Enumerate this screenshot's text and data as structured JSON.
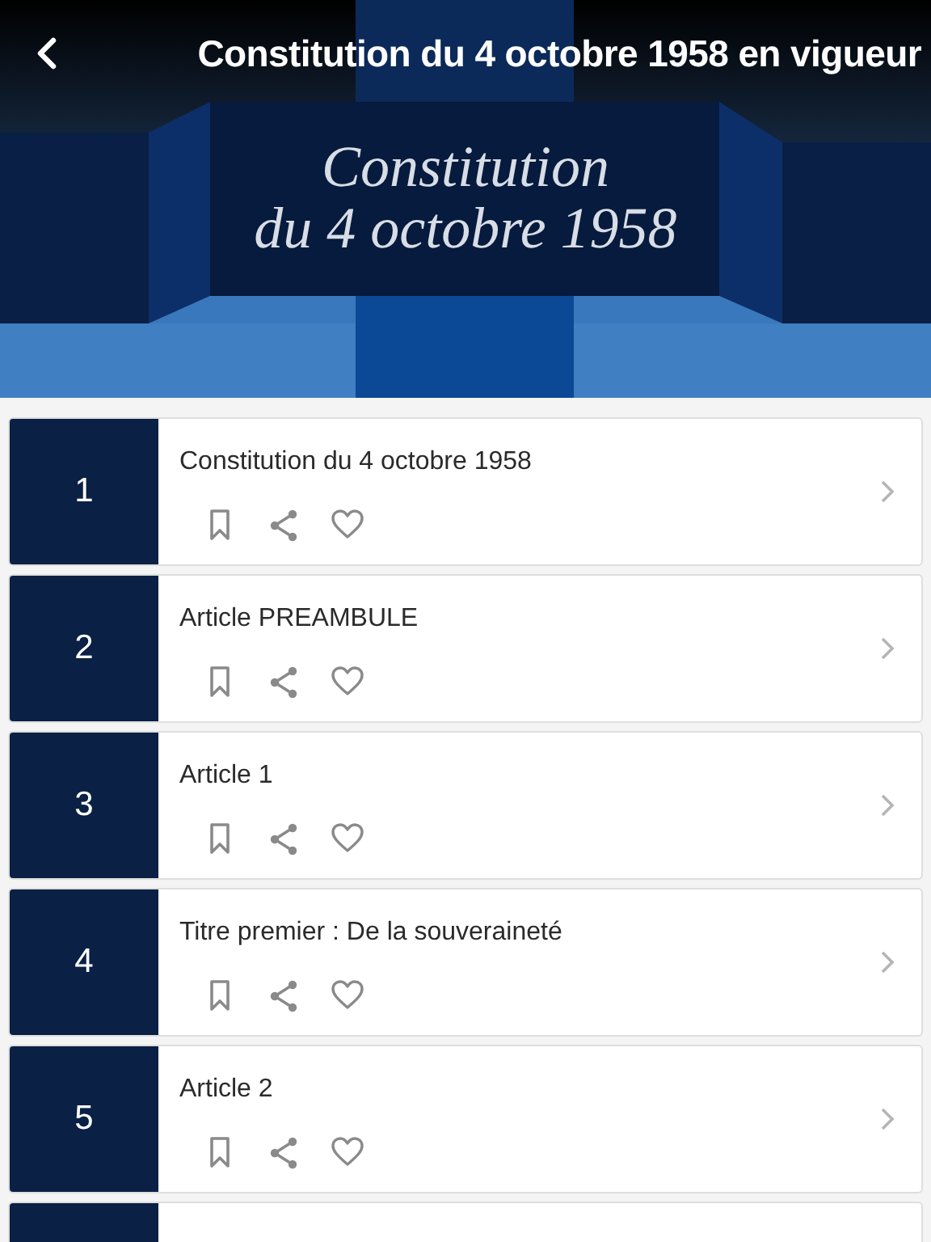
{
  "header": {
    "title": "Constitution du 4 octobre 1958 en vigueur"
  },
  "banner": {
    "lines": [
      "Constitution",
      "du 4 octobre 1958"
    ]
  },
  "items": [
    {
      "kind": "entry",
      "number": "1",
      "title": "Constitution du 4 octobre 1958"
    },
    {
      "kind": "entry",
      "number": "2",
      "title": "Article PREAMBULE"
    },
    {
      "kind": "entry",
      "number": "3",
      "title": "Article 1"
    },
    {
      "kind": "entry",
      "number": "4",
      "title": "Titre premier : De la souveraineté"
    },
    {
      "kind": "entry",
      "number": "5",
      "title": "Article 2"
    },
    {
      "kind": "partial"
    }
  ]
}
